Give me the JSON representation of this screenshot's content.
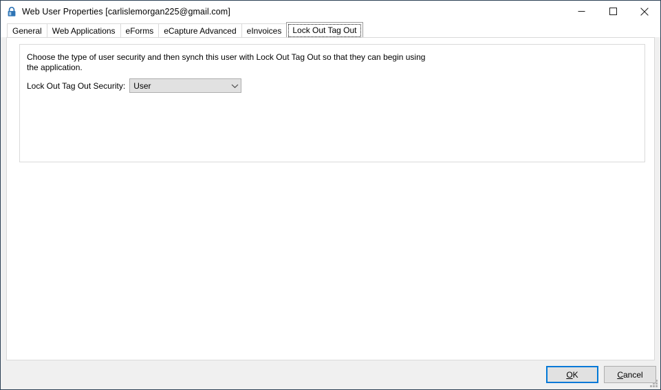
{
  "window": {
    "title": "Web User Properties [carlislemorgan225@gmail.com]",
    "icon": "padlock-icon",
    "controls": {
      "minimize": "—",
      "maximize": "□",
      "close": "✕"
    },
    "border_color": "#2b3f54"
  },
  "tabs": [
    {
      "label": "General",
      "selected": false
    },
    {
      "label": "Web Applications",
      "selected": false
    },
    {
      "label": "eForms",
      "selected": false
    },
    {
      "label": "eCapture Advanced",
      "selected": false
    },
    {
      "label": "eInvoices",
      "selected": false
    },
    {
      "label": "Lock Out Tag Out",
      "selected": true
    }
  ],
  "panel": {
    "description": "Choose the type of user security and then synch this user with Lock Out Tag Out so that they can begin using the application.",
    "security_label": "Lock Out Tag Out Security:",
    "security_value": "User",
    "security_options": [
      "User"
    ],
    "dropdown_icon": "chevron-down-icon"
  },
  "footer": {
    "ok_label": "OK",
    "ok_accel": "O",
    "ok_rest": "K",
    "cancel_label": "Cancel",
    "cancel_accel": "C",
    "cancel_rest": "ancel",
    "focus_color": "#0078d7",
    "grip": "resize-grip"
  }
}
